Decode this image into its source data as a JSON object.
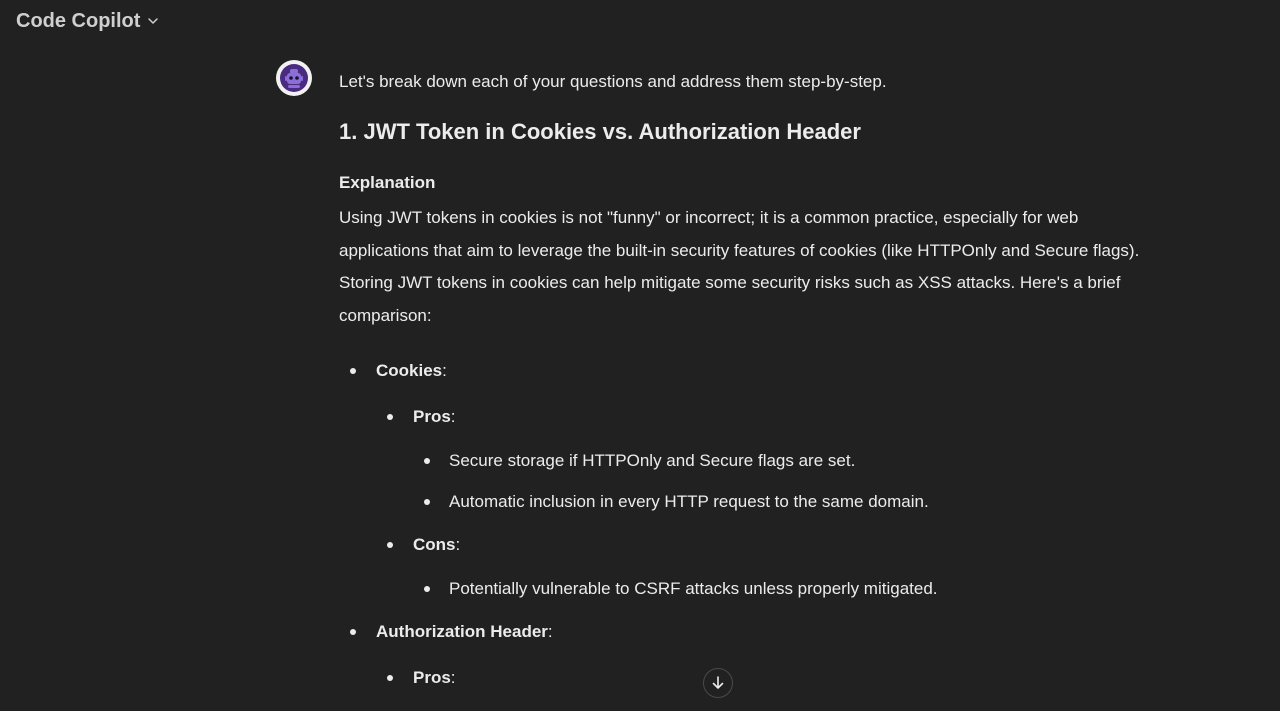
{
  "header": {
    "model_name": "Code Copilot",
    "chevron_icon": "chevron-down-icon"
  },
  "assistant": {
    "avatar_icon": "robot-icon",
    "avatar_color": "#4b2a82"
  },
  "message": {
    "intro": "Let's break down each of your questions and address them step-by-step.",
    "section_title": "1. JWT Token in Cookies vs. Authorization Header",
    "subsection_title": "Explanation",
    "paragraph": "Using JWT tokens in cookies is not \"funny\" or incorrect; it is a common practice, especially for web applications that aim to leverage the built-in security features of cookies (like HTTPOnly and Secure flags). Storing JWT tokens in cookies can help mitigate some security risks such as XSS attacks. Here's a brief comparison:",
    "list": [
      {
        "label": "Cookies",
        "suffix": ":",
        "children": [
          {
            "label": "Pros",
            "suffix": ":",
            "items": [
              "Secure storage if HTTPOnly and Secure flags are set.",
              "Automatic inclusion in every HTTP request to the same domain."
            ]
          },
          {
            "label": "Cons",
            "suffix": ":",
            "items": [
              "Potentially vulnerable to CSRF attacks unless properly mitigated."
            ]
          }
        ]
      },
      {
        "label": "Authorization Header",
        "suffix": ":",
        "children": [
          {
            "label": "Pros",
            "suffix": ":"
          }
        ]
      }
    ]
  },
  "scroll_button": {
    "icon": "arrow-down-icon"
  }
}
